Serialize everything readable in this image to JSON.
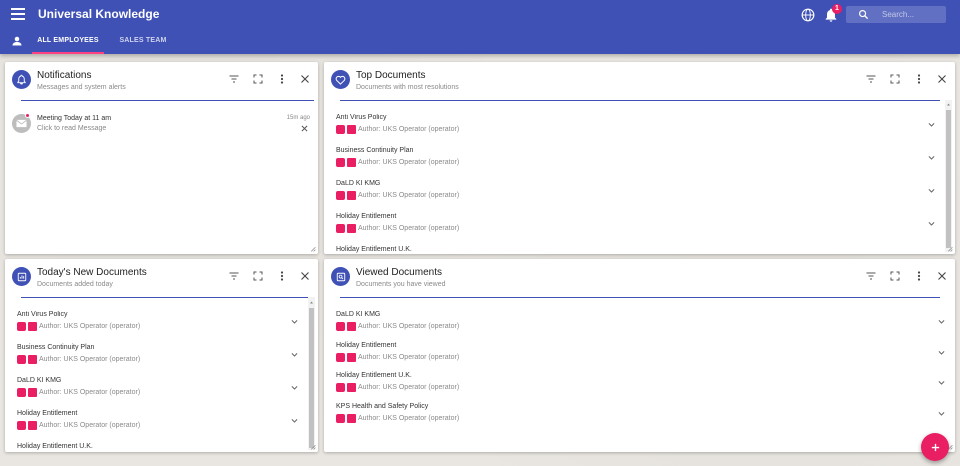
{
  "app": {
    "title": "Universal Knowledge",
    "notification_count": "1",
    "search_placeholder": "Search...",
    "accent_color": "#3f51b5",
    "badge_color": "#e91e63"
  },
  "tabs": [
    {
      "label": "ALL EMPLOYEES",
      "active": true
    },
    {
      "label": "SALES TEAM",
      "active": false
    }
  ],
  "notifications": {
    "title": "Notifications",
    "subtitle": "Messages and system alerts",
    "icon": "bell-icon",
    "items": [
      {
        "title": "Meeting Today at 11 am",
        "message": "Click to read Message",
        "time": "15m ago"
      }
    ]
  },
  "top_documents": {
    "title": "Top Documents",
    "subtitle": "Documents with most resolutions",
    "icon": "heart-icon",
    "items": [
      {
        "title": "Anti Virus Policy",
        "author": "Author: UKS Operator (operator)"
      },
      {
        "title": "Business Continuity Plan",
        "author": "Author: UKS Operator (operator)"
      },
      {
        "title": "DaLD KI KMG",
        "author": "Author: UKS Operator (operator)"
      },
      {
        "title": "Holiday Entitlement",
        "author": "Author: UKS Operator (operator)"
      },
      {
        "title": "Holiday Entitlement U.K.",
        "author": ""
      }
    ]
  },
  "new_documents": {
    "title": "Today's New Documents",
    "subtitle": "Documents added today",
    "icon": "document-icon",
    "items": [
      {
        "title": "Anti Virus Policy",
        "author": "Author: UKS Operator (operator)"
      },
      {
        "title": "Business Continuity Plan",
        "author": "Author: UKS Operator (operator)"
      },
      {
        "title": "DaLD KI KMG",
        "author": "Author: UKS Operator (operator)"
      },
      {
        "title": "Holiday Entitlement",
        "author": "Author: UKS Operator (operator)"
      },
      {
        "title": "Holiday Entitlement U.K.",
        "author": ""
      }
    ]
  },
  "viewed_documents": {
    "title": "Viewed Documents",
    "subtitle": "Documents you have viewed",
    "icon": "search-document-icon",
    "items": [
      {
        "title": "DaLD KI KMG",
        "author": "Author: UKS Operator (operator)"
      },
      {
        "title": "Holiday Entitlement",
        "author": "Author: UKS Operator (operator)"
      },
      {
        "title": "Holiday Entitlement U.K.",
        "author": "Author: UKS Operator (operator)"
      },
      {
        "title": "KPS Health and Safety Policy",
        "author": "Author: UKS Operator (operator)"
      }
    ]
  }
}
